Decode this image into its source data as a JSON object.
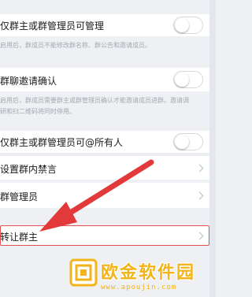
{
  "settings": {
    "admin_only_edit": {
      "label": "仅群主或群管理员可管理",
      "description": "启用后，群成员不能修改群名称、群公告和邀请成员。",
      "enabled": false
    },
    "invite_confirm": {
      "label": "群聊邀请确认",
      "description_line1": "启用后，群成员需要群主或群管理员确认才能邀请成员进群。邀请调",
      "description_line2": "研和扫二维码将同时停用。",
      "enabled": false
    },
    "at_all": {
      "label": "仅群主或群管理员可@所有人",
      "enabled": false
    },
    "mute_members": {
      "label": "设置群内禁言"
    },
    "group_admins": {
      "label": "群管理员"
    },
    "transfer_owner": {
      "label": "转让群主"
    }
  },
  "watermark": {
    "title": "欧金软件园",
    "url": "www.apoujin.com"
  },
  "colors": {
    "background": "#eef0f4",
    "card": "#ffffff",
    "highlight": "#e65050",
    "arrow": "#e23a3a",
    "watermark": "#f3b31a"
  }
}
